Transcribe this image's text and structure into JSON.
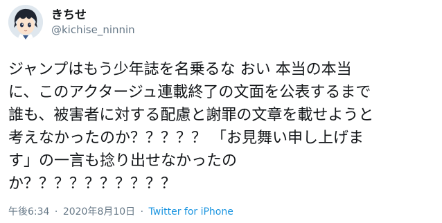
{
  "user": {
    "display_name": "きちせ",
    "handle": "@kichise_ninnin"
  },
  "tweet": {
    "lines": [
      "ジャンプはもう少年誌を名乗るな おい 本当の本当",
      "に、このアクタージュ連載終了の文面を公表するまで",
      "誰も、被害者に対する配慮と謝罪の文章を載せようと",
      "考えなかったのか？？？？？ 「お見舞い申し上げま",
      "す」の一言も捻り出せなかったの",
      "か？？？？？？？？？？"
    ]
  },
  "meta": {
    "time": "午後6:34",
    "separator": "·",
    "date": "2020年8月10日",
    "source": "Twitter for iPhone"
  },
  "colors": {
    "text": "#14171a",
    "secondary": "#657786",
    "link": "#1b95e0"
  },
  "icons": {
    "avatar": "anime-boy-avatar"
  }
}
